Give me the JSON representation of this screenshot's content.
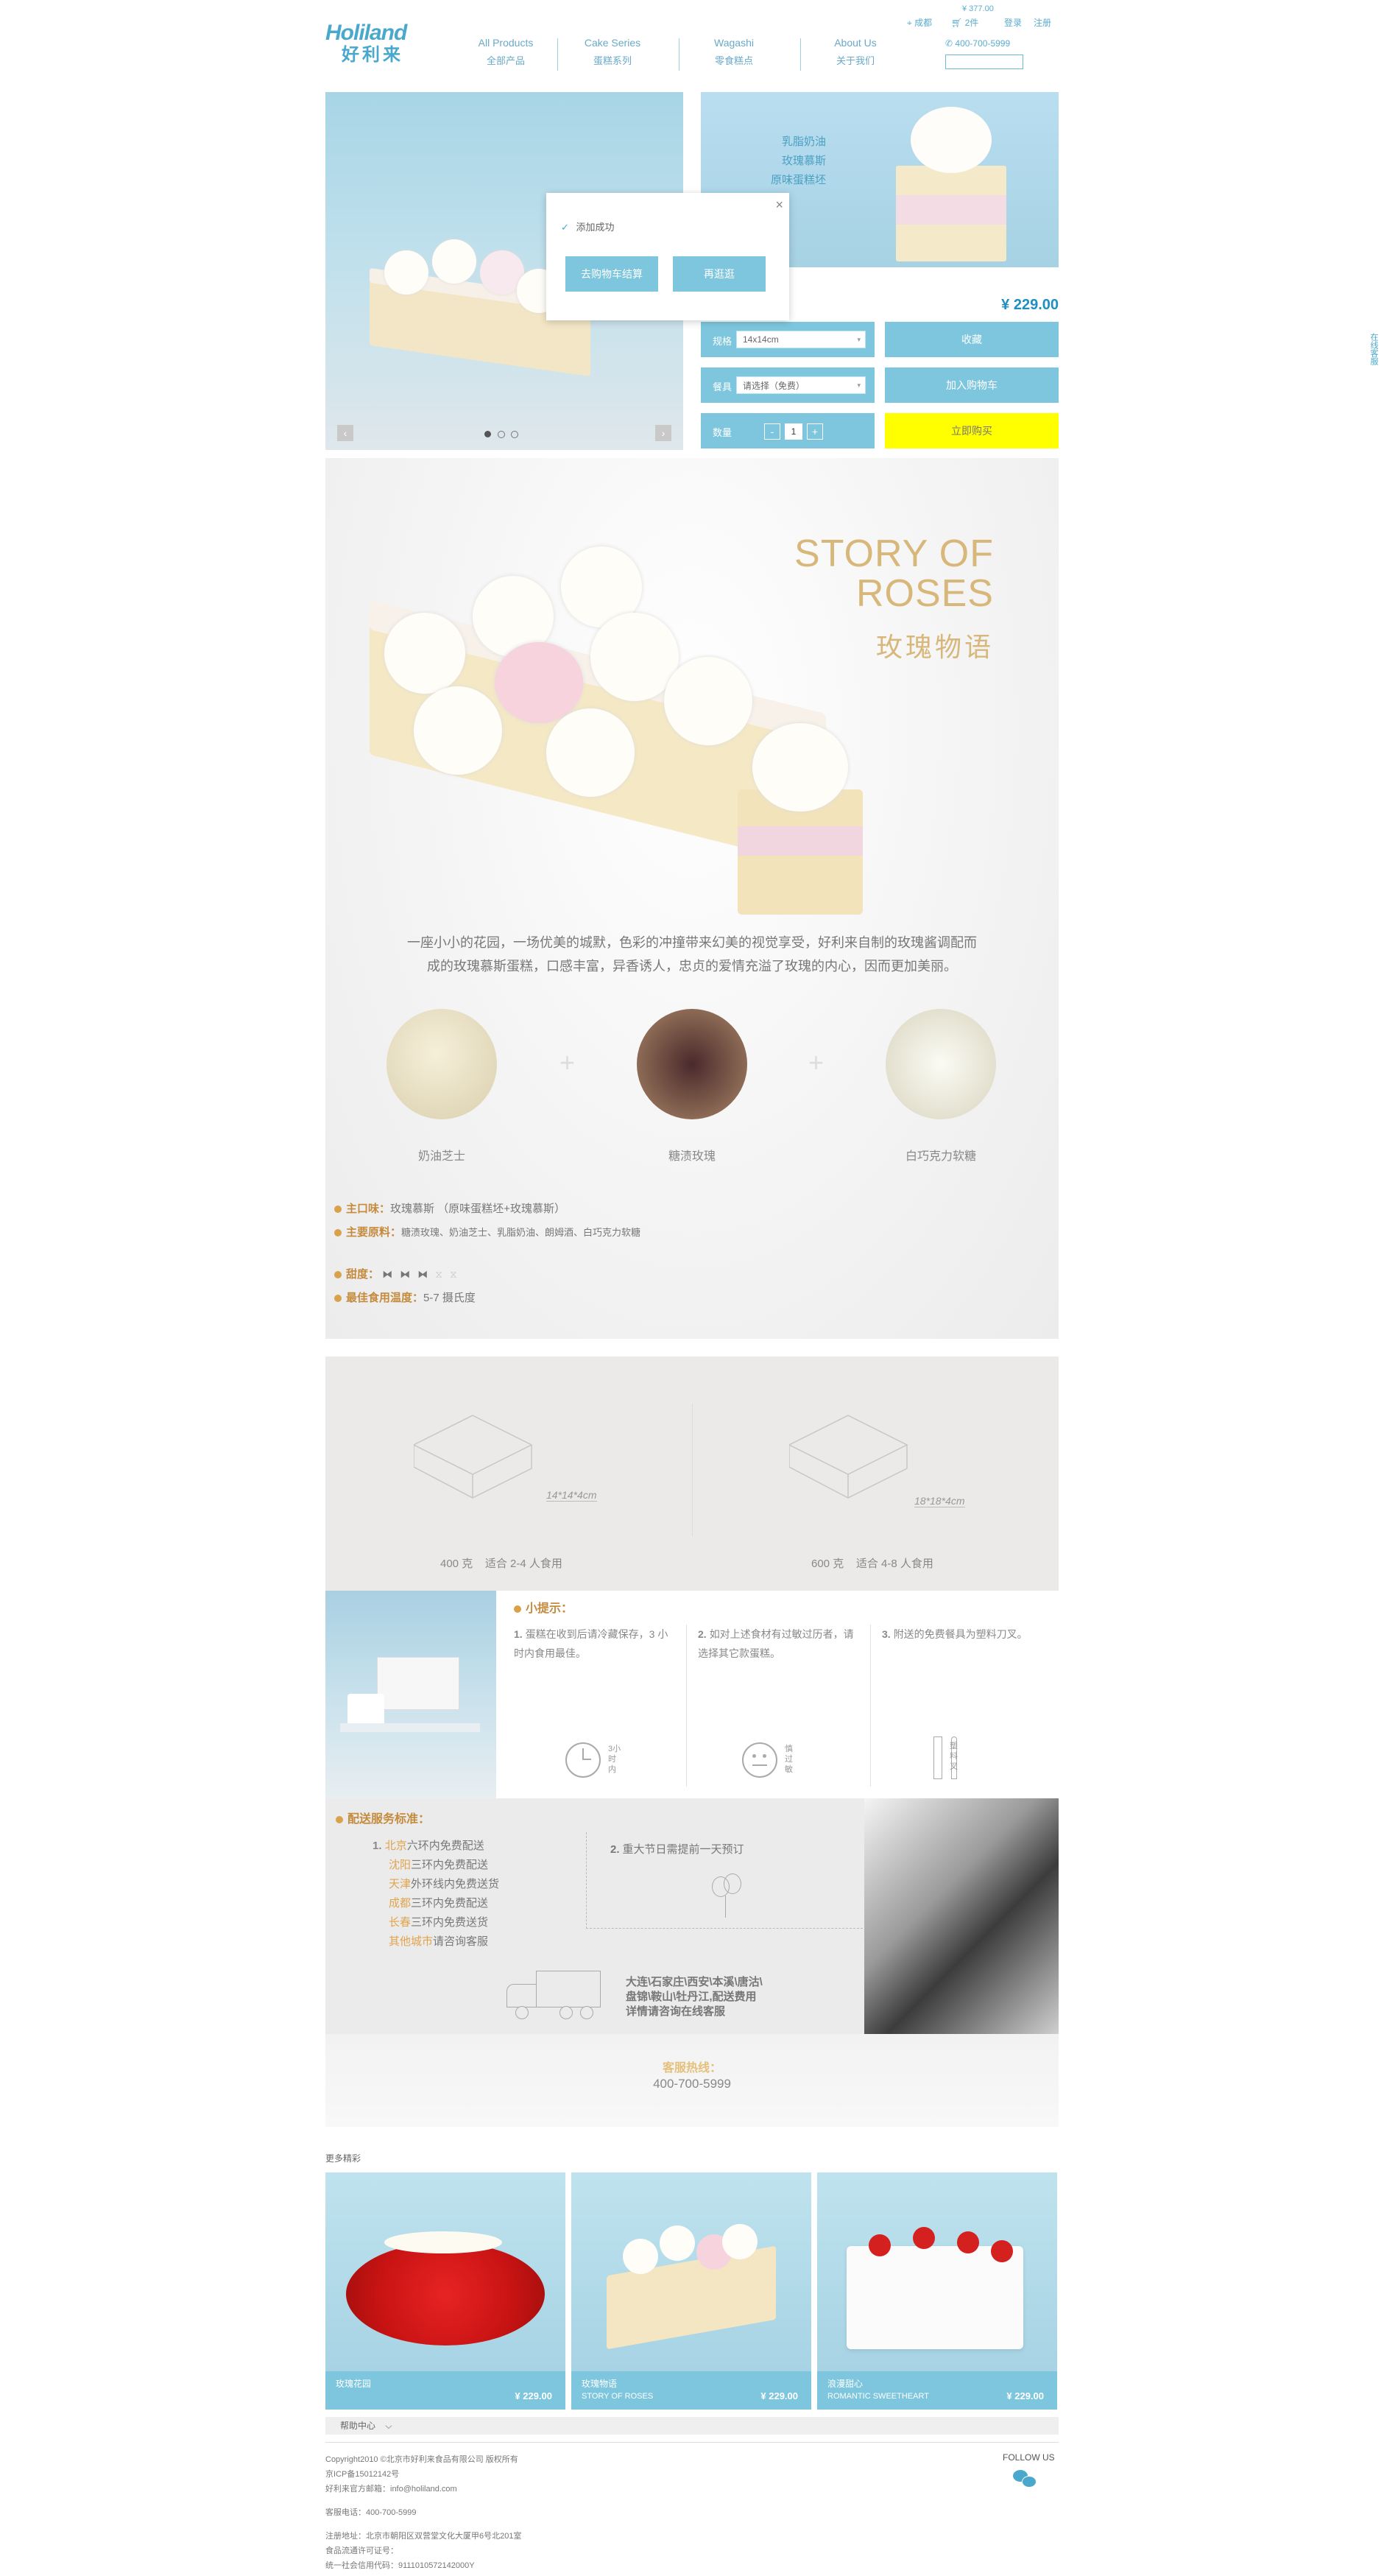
{
  "brand": {
    "logo_en": "Holiland",
    "logo_cn": "好利来"
  },
  "topbar": {
    "city": "成都",
    "cart_price": "¥ 377.00",
    "cart_count": "2件",
    "login": "登录",
    "register": "注册",
    "phone": "400-700-5999"
  },
  "nav": [
    {
      "en": "All Products",
      "cn": "全部产品"
    },
    {
      "en": "Cake Series",
      "cn": "蛋糕系列"
    },
    {
      "en": "Wagashi",
      "cn": "零食糕点"
    },
    {
      "en": "About Us",
      "cn": "关于我们"
    }
  ],
  "search": {
    "placeholder": ""
  },
  "side_service": "在线客服",
  "modal": {
    "message": "添加成功",
    "btn_cart": "去购物车结算",
    "btn_continue": "再逛逛",
    "close": "×"
  },
  "product": {
    "tags": [
      "乳脂奶油",
      "玫瑰慕斯",
      "原味蛋糕坯"
    ],
    "price": "¥ 229.00",
    "spec_label": "规格",
    "spec_value": "14x14cm",
    "extra_label": "餐具",
    "extra_value": "请选择（免费）",
    "qty_label": "数量",
    "qty_value": "1",
    "qty_minus": "-",
    "qty_plus": "+",
    "btn_collect": "收藏",
    "btn_cart": "加入购物车",
    "btn_buy": "立即购买",
    "carousel_dots": 3
  },
  "story": {
    "title_en_1": "STORY OF",
    "title_en_2": "ROSES",
    "title_cn": "玫瑰物语",
    "desc_1": "一座小小的花园，一场优美的城默，色彩的冲撞带来幻美的视觉享受，好利来自制的玫瑰酱调配而",
    "desc_2": "成的玫瑰慕斯蛋糕，口感丰富，异香诱人，忠贞的爱情充溢了玫瑰的内心，因而更加美丽。",
    "ingredients": [
      "奶油芝士",
      "糖渍玫瑰",
      "白巧克力软糖"
    ],
    "taste_label": "主口味：",
    "taste_value": "玫瑰慕斯 （原味蛋糕坯+玫瑰慕斯）",
    "material_label": "主要原料：",
    "material_value": "糖渍玫瑰、奶油芝士、乳脂奶油、朗姆酒、白巧克力软糖",
    "sweet_label": "甜度：",
    "sweet_level": 3,
    "sweet_max": 5,
    "temp_label": "最佳食用温度：",
    "temp_value": "5-7 摄氏度"
  },
  "sizes": [
    {
      "dim": "14*14*4cm",
      "desc": "400 克    适合 2-4 人食用"
    },
    {
      "dim": "18*18*4cm",
      "desc": "600 克    适合 4-8 人食用"
    }
  ],
  "tips": {
    "title": "小提示：",
    "items": [
      {
        "num": "1.",
        "text": "蛋糕在收到后请冷藏保存，3 小时内食用最佳。",
        "icon_label": "3小时内"
      },
      {
        "num": "2.",
        "text": "如对上述食材有过敏过历者，请选择其它款蛋糕。",
        "icon_label": "慎过敏"
      },
      {
        "num": "3.",
        "text": "附送的免费餐具为塑料刀叉。",
        "icon_label": "塑料叉"
      }
    ]
  },
  "delivery": {
    "title": "配送服务标准：",
    "rules": [
      {
        "city": "北京",
        "rest": "六环内免费配送"
      },
      {
        "city": "沈阳",
        "rest": "三环内免费配送"
      },
      {
        "city": "天津",
        "rest": "外环线内免费送货"
      },
      {
        "city": "成都",
        "rest": "三环内免费配送"
      },
      {
        "city": "长春",
        "rest": "三环内免费送货"
      },
      {
        "city": "其他城市",
        "rest": "请咨询客服"
      }
    ],
    "holiday_num": "2.",
    "holiday": "重大节日需提前一天预订",
    "other_1": "大连\\石家庄\\西安\\本溪\\唐沽\\",
    "other_2": "盘锦\\鞍山\\牡丹江,配送费用",
    "other_3": "详情请咨询在线客服"
  },
  "hotline": {
    "label": "客服热线：",
    "number": "400-700-5999"
  },
  "more": {
    "title": "更多精彩",
    "products": [
      {
        "name": "玫瑰花园",
        "sub": "",
        "price": "¥ 229.00"
      },
      {
        "name": "玫瑰物语",
        "sub": "STORY OF ROSES",
        "price": "¥ 229.00"
      },
      {
        "name": "浪漫甜心",
        "sub": "ROMANTIC SWEETHEART",
        "price": "¥ 229.00"
      }
    ]
  },
  "footer": {
    "help": "帮助中心",
    "follow": "FOLLOW US",
    "lines": [
      "Copyright2010 ©北京市好利来食品有限公司 版权所有",
      "京ICP备15012142号",
      "好利来官方邮箱：info@holiland.com",
      "客服电话：400-700-5999",
      "注册地址：北京市朝阳区双营堂文化大厦甲6号北201室",
      "食品流通许可证号：",
      "统一社会信用代码：9111010572142000Y"
    ]
  },
  "colors": {
    "accent": "#7dc6dd",
    "buy": "#ffff00",
    "gold": "#d8a24a",
    "price": "#1f8fc1"
  }
}
